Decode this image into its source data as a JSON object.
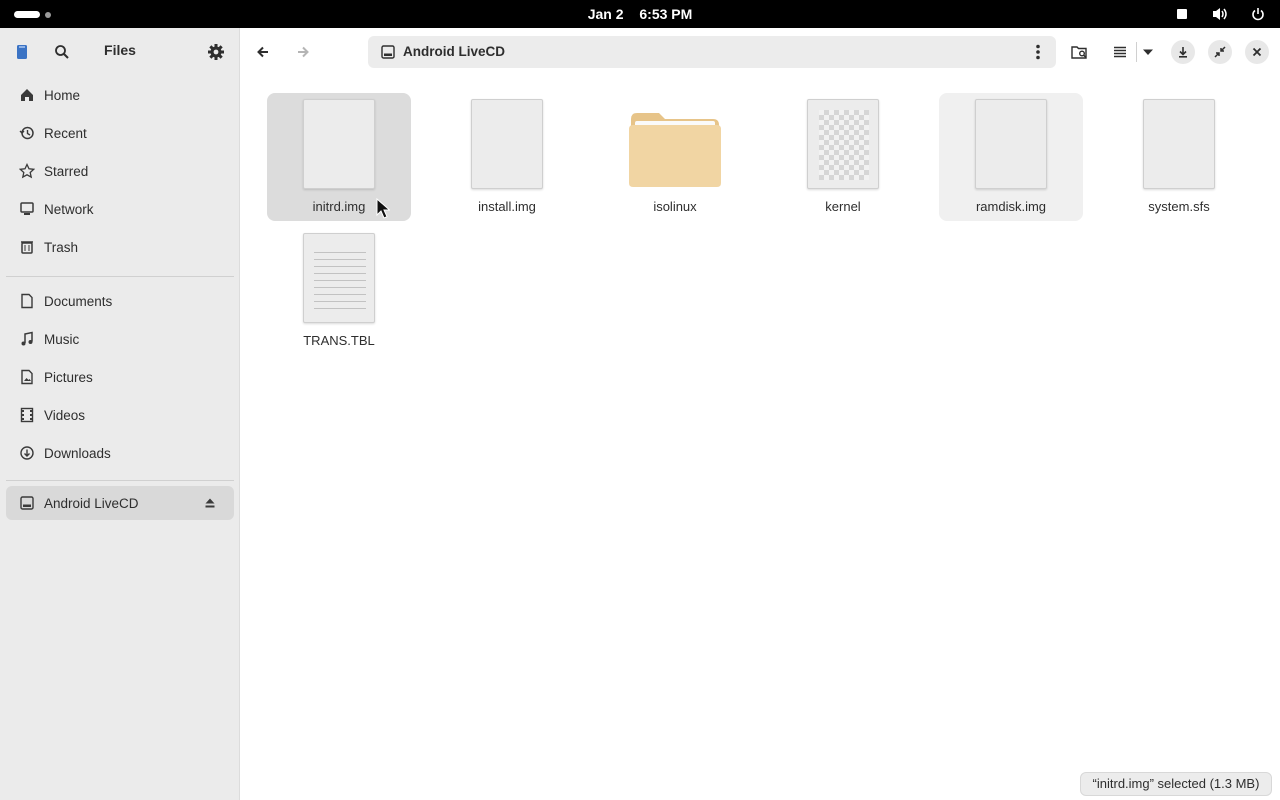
{
  "topbar": {
    "date": "Jan 2",
    "time": "6:53 PM"
  },
  "app": {
    "title": "Files"
  },
  "sidebar": {
    "places": [
      {
        "label": "Home",
        "icon": "home-icon"
      },
      {
        "label": "Recent",
        "icon": "clock-icon"
      },
      {
        "label": "Starred",
        "icon": "star-icon"
      },
      {
        "label": "Network",
        "icon": "network-icon"
      },
      {
        "label": "Trash",
        "icon": "trash-icon"
      }
    ],
    "bookmarks": [
      {
        "label": "Documents",
        "icon": "document-icon"
      },
      {
        "label": "Music",
        "icon": "music-icon"
      },
      {
        "label": "Pictures",
        "icon": "pictures-icon"
      },
      {
        "label": "Videos",
        "icon": "video-icon"
      },
      {
        "label": "Downloads",
        "icon": "download-icon"
      }
    ],
    "devices": [
      {
        "label": "Android LiveCD",
        "icon": "drive-icon",
        "active": true
      }
    ]
  },
  "location": {
    "label": "Android LiveCD"
  },
  "files": [
    {
      "name": "initrd.img",
      "type": "file",
      "state": "selected"
    },
    {
      "name": "install.img",
      "type": "file",
      "state": ""
    },
    {
      "name": "isolinux",
      "type": "folder",
      "state": ""
    },
    {
      "name": "kernel",
      "type": "binary",
      "state": ""
    },
    {
      "name": "ramdisk.img",
      "type": "file",
      "state": "hover"
    },
    {
      "name": "system.sfs",
      "type": "file",
      "state": ""
    },
    {
      "name": "TRANS.TBL",
      "type": "text",
      "state": ""
    }
  ],
  "status": "“initrd.img” selected  (1.3 MB)",
  "colors": {
    "folder": "#f1d5a3",
    "selection": "#dcdcdc",
    "sidebar_bg": "#ebebeb",
    "accent": "#3584e4"
  }
}
